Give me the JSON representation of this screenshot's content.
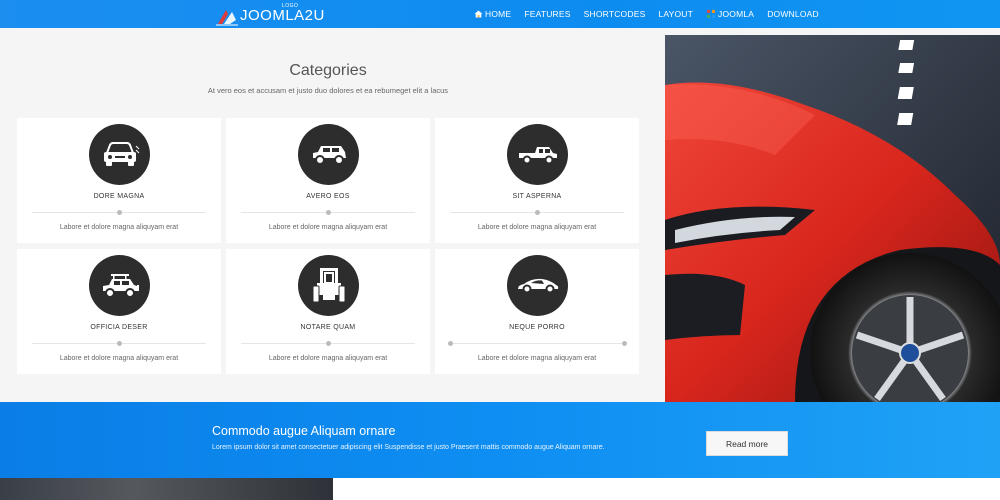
{
  "header": {
    "logo_text": "JOOMLA2U",
    "logo_small": "LOGO",
    "nav": [
      {
        "label": "HOME",
        "icon": "home-icon"
      },
      {
        "label": "FEATURES"
      },
      {
        "label": "SHORTCODES"
      },
      {
        "label": "LAYOUT"
      },
      {
        "label": "JOOMLA",
        "icon": "joomla-icon"
      },
      {
        "label": "DOWNLOAD"
      }
    ]
  },
  "categories": {
    "title": "Categories",
    "subtitle": "At vero eos et accusam et justo duo dolores et ea rebumeget elit a lacus",
    "items": [
      {
        "title": "DORE MAGNA",
        "text": "Labore et dolore magna aliquyam erat",
        "icon": "car-front-icon",
        "slider": 0.5
      },
      {
        "title": "AVERO EOS",
        "text": "Labore et dolore magna aliquyam erat",
        "icon": "suv-icon",
        "slider": 0.5
      },
      {
        "title": "SIT ASPERNA",
        "text": "Labore et dolore magna aliquyam erat",
        "icon": "pickup-icon",
        "slider": 0.5
      },
      {
        "title": "OFFICIA DESER",
        "text": "Labore et dolore magna aliquyam erat",
        "icon": "offroad-icon",
        "slider": 0.5
      },
      {
        "title": "NOTARE QUAM",
        "text": "Labore et dolore magna aliquyam erat",
        "icon": "tractor-icon",
        "slider": 0.5
      },
      {
        "title": "NEQUE PORRO",
        "text": "Labore et dolore magna aliquyam erat",
        "icon": "sports-car-icon",
        "slider": 0.0
      }
    ]
  },
  "cta": {
    "title": "Commodo augue Aliquam ornare",
    "text": "Lorem ipsum dolor sit amet consectetuer adipiscing elit Suspendisse et justo Praesent mattis commodo augue Aliquam ornare.",
    "button": "Read more"
  },
  "colors": {
    "accent": "#0e8ef2",
    "card_icon_bg": "#2d2d2d",
    "car": "#d8261d"
  }
}
